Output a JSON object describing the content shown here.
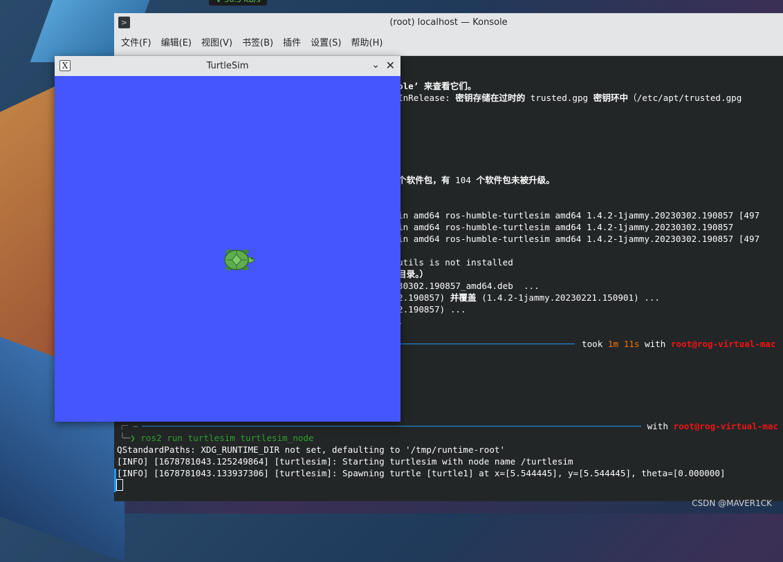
{
  "taskbar": {
    "net_speed": "↓ 56.3 KB/s"
  },
  "konsole": {
    "title": "(root) localhost — Konsole",
    "menu": [
      "文件(F)",
      "编辑(E)",
      "视图(V)",
      "书签(B)",
      "插件",
      "设置(S)",
      "帮助(H)"
    ],
    "lines": {
      "l1": "ole’ 来查看它们。",
      "l2a": "InRelease: ",
      "l2b": "密钥存储在过时的",
      "l2c": " trusted.gpg ",
      "l2d": "密钥环中",
      "l2e": "（/etc/apt/trusted.gpg",
      "l3a": "个软件包，有 ",
      "l3b": "104",
      "l3c": " 个软件包未被升级。",
      "l4": "in amd64 ros-humble-turtlesim amd64 1.4.2-1jammy.20230302.190857 [497",
      "l5": "in amd64 ros-humble-turtlesim amd64 1.4.2-1jammy.20230302.190857",
      "l6": "in amd64 ros-humble-turtlesim amd64 1.4.2-1jammy.20230302.190857 [497",
      "l7": "utils is not installed",
      "l8": "目录。）",
      "l9": "30302.190857_amd64.deb  ...",
      "l10a": "2.190857) ",
      "l10b": "并覆盖",
      "l10c": " (1.4.2-1jammy.20230221.150901) ...",
      "l11": "2.190857) ...",
      "l12": "."
    },
    "prompt1": {
      "took": "took ",
      "dur1": "1m",
      "dur2": "11s",
      "with": " with ",
      "user": "root@rog-virtual-mac"
    },
    "prompt2": {
      "dir": "~",
      "with": " with ",
      "user": "root@rog-virtual-mac"
    },
    "command": "ros2 run turtlesim turtlesim_node",
    "output": [
      "QStandardPaths: XDG_RUNTIME_DIR not set, defaulting to '/tmp/runtime-root'",
      "[INFO] [1678781043.125249864] [turtlesim]: Starting turtlesim with node name /turtlesim",
      "[INFO] [1678781043.133937306] [turtlesim]: Spawning turtle [turtle1] at x=[5.544445], y=[5.544445], theta=[0.000000]"
    ]
  },
  "turtlesim": {
    "title": "TurtleSim",
    "background_color": "#4556ff"
  },
  "watermark": "CSDN @MAVER1CK"
}
